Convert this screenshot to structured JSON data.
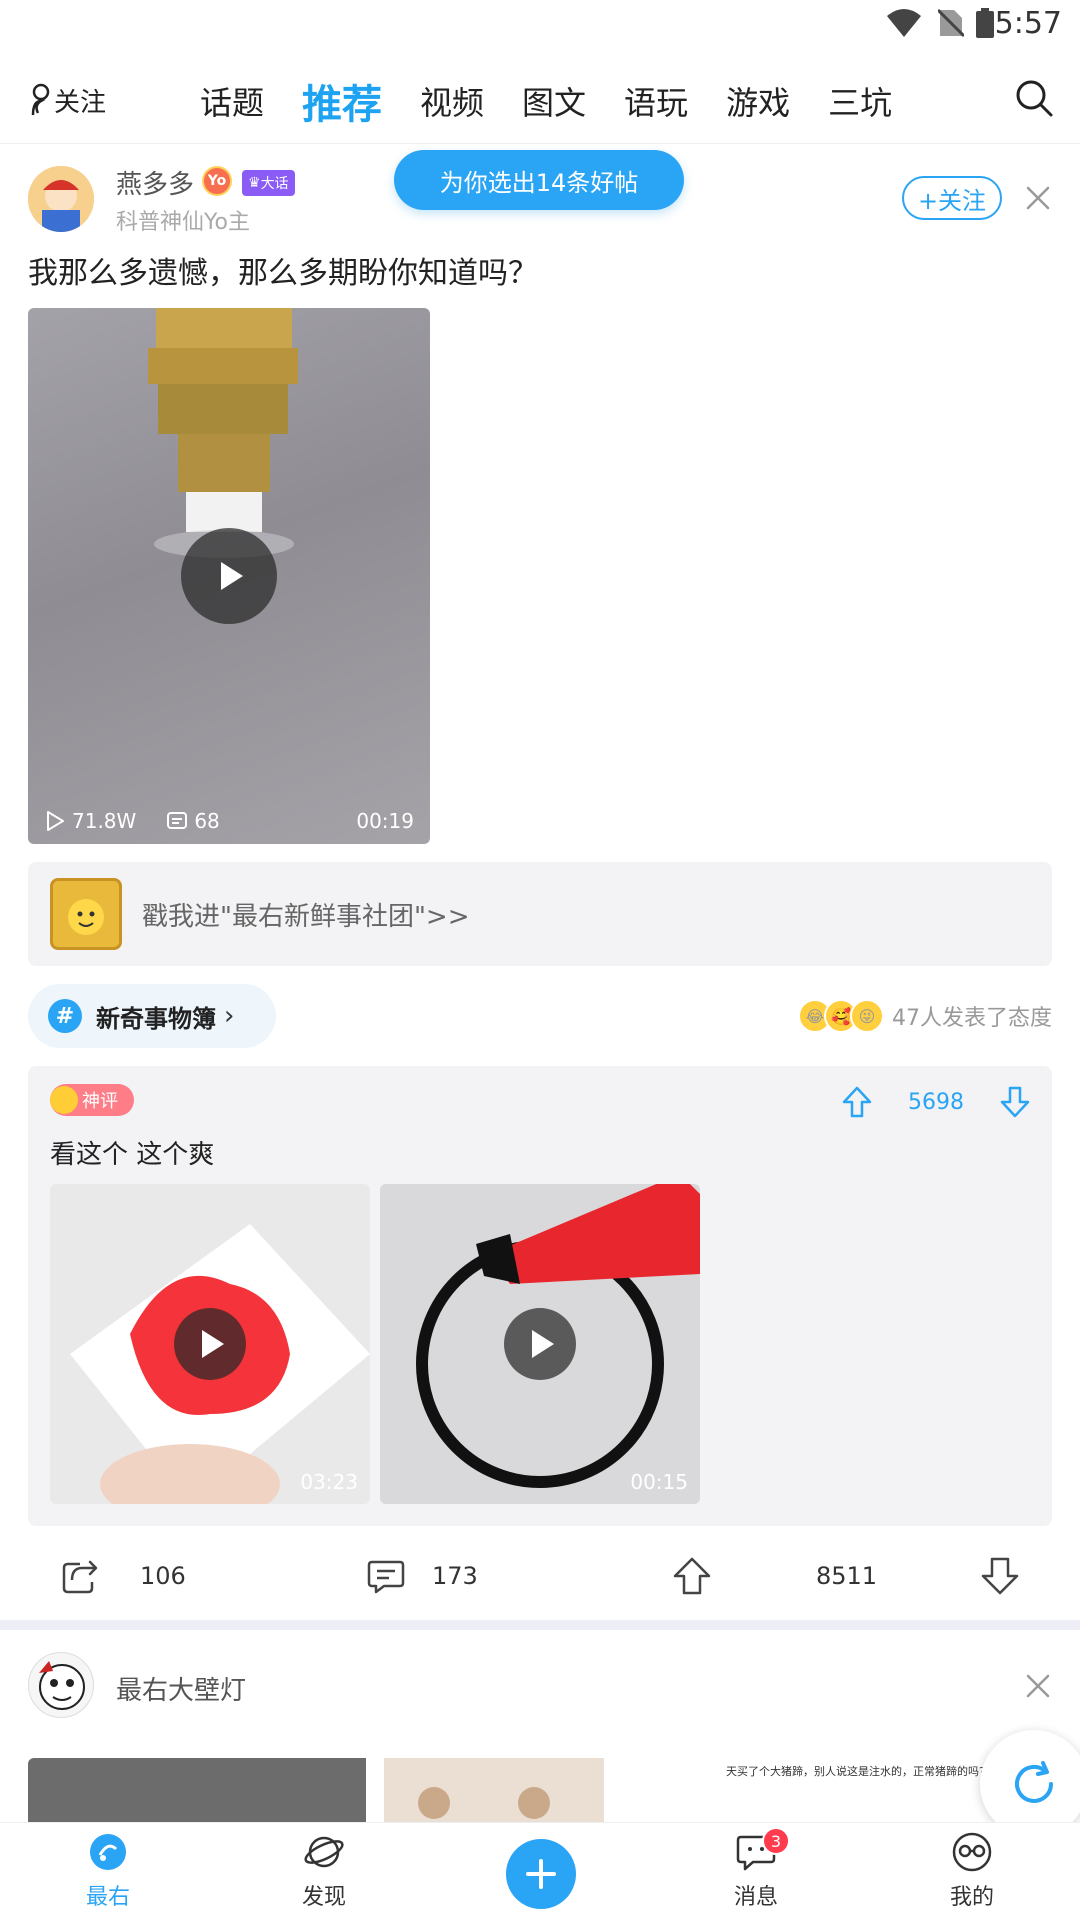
{
  "status_bar": {
    "time": "5:57"
  },
  "top_nav": {
    "follow_label": "关注",
    "tabs": [
      "话题",
      "推荐",
      "视频",
      "图文",
      "语玩",
      "游戏",
      "三坑"
    ],
    "active_tab": "推荐"
  },
  "toast": {
    "text": "为你选出14条好帖"
  },
  "post1": {
    "author": "燕多多",
    "yo_badge": "Yo",
    "vip_badge": "大话",
    "subtitle": "科普神仙Yo主",
    "follow_button": "+关注",
    "title": "我那么多遗憾，那么多期盼你知道吗？",
    "video": {
      "plays": "71.8W",
      "comments": "68",
      "duration": "00:19"
    },
    "community": {
      "text": "戳我进\"最右新鲜事社团\">>"
    },
    "topic": {
      "hash": "#",
      "label": "新奇事物簿",
      "chevron": "›"
    },
    "attitude_text": "47人发表了态度",
    "top_comment": {
      "badge": "神评",
      "votes": "5698",
      "text": "看这个 这个爽",
      "videos": [
        {
          "duration": "03:23"
        },
        {
          "duration": "00:15"
        }
      ]
    },
    "actions": {
      "share": "106",
      "comment": "173",
      "likes": "8511"
    }
  },
  "post2": {
    "author": "最右大壁灯",
    "strip_text": "天买了个大猪蹄，别人说这是注水的，正常猪蹄的吗?"
  },
  "bottom_nav": {
    "items": [
      "最右",
      "发现",
      "消息",
      "我的"
    ],
    "message_badge": "3"
  },
  "colors": {
    "accent": "#2aa4f4",
    "badge_red": "#ff3b4e"
  }
}
